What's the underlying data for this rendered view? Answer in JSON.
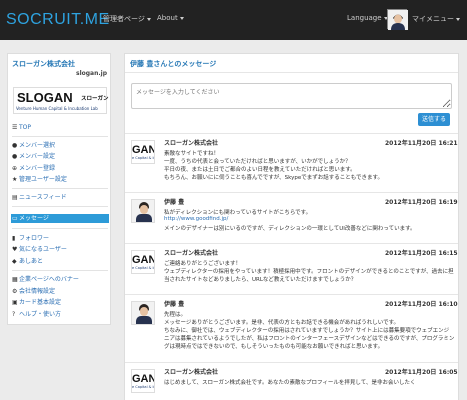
{
  "navbar": {
    "brand": "SOCRUIT.ME",
    "menu_admin": "管理者ページ",
    "menu_about": "About",
    "menu_language": "Language",
    "menu_mymenu": "マイメニュー"
  },
  "sidebar": {
    "company": "スローガン株式会社",
    "url": "slogan.jp",
    "logo": {
      "main": "SLOGAN",
      "jp": "スローガン",
      "sub": "Venture Human Capital & Incubation Lab"
    },
    "items": [
      {
        "label": "TOP",
        "icon": "list-icon"
      },
      {
        "label": "メンバー選択",
        "icon": "user-icon"
      },
      {
        "label": "メンバー設定",
        "icon": "users-icon"
      },
      {
        "label": "メンバー登録",
        "icon": "plus-icon"
      },
      {
        "label": "管理ユーザー設定",
        "icon": "star-icon"
      },
      {
        "label": "ニュースフィード",
        "icon": "newspaper-icon"
      },
      {
        "label": "メッセージ",
        "icon": "inbox-icon"
      },
      {
        "label": "フォロワー",
        "icon": "bookmark-icon"
      },
      {
        "label": "気になるユーザー",
        "icon": "heart-icon"
      },
      {
        "label": "あしあと",
        "icon": "footprint-icon"
      },
      {
        "label": "企業ページへのバナー",
        "icon": "banner-icon"
      },
      {
        "label": "会社情報設定",
        "icon": "gear-icon"
      },
      {
        "label": "カード基本設定",
        "icon": "card-icon"
      },
      {
        "label": "ヘルプ・使い方",
        "icon": "help-icon"
      }
    ]
  },
  "main": {
    "title": "伊藤 豊さんとのメッセージ",
    "compose_placeholder": "メッセージを入力してください",
    "send_label": "送信する",
    "messages": [
      {
        "author": "スローガン株式会社",
        "date": "2012年11月20日 16:21",
        "avatar": "company",
        "lines": [
          "素敵なサイトですね！",
          "一度、うちの代表と会っていただければと思いますが、いかがでしょうか？",
          "平日の夜、または土日でご都合のよい日程を教えていただければと思います。",
          "もちろん、お願いにに伺うことも喜んでですが、Skypeでまずお話することもできます。"
        ]
      },
      {
        "author": "伊藤 豊",
        "date": "2012年11月20日 16:19",
        "avatar": "person",
        "lines": [
          "私がディレクションにも関わっているサイトがこちらです。",
          "http://www.goodfind.jp/",
          "メインのデザイナーは別にいるのですが、ディレクションの一環としてUI改善などに関わっています。"
        ],
        "link_line": 1
      },
      {
        "author": "スローガン株式会社",
        "date": "2012年11月20日 16:15",
        "avatar": "company",
        "lines": [
          "ご連絡ありがとうございます！",
          "ウェブディレクターの採用をやっています！積極採用中です。フロントのデザインができるとのことですが、過去に担",
          "当されたサイトなどありましたら、URLなど教えていただけますでしょうか？"
        ]
      },
      {
        "author": "伊藤 豊",
        "date": "2012年11月20日 16:10",
        "avatar": "person",
        "lines": [
          "先程は。",
          "メッセージありがとうございます。是非、代表の方ともお話できる機会があればうれしいです。",
          "ちなみに、御社では、ウェブディレクターの採用はされていますでしょうか？サイト上には募集要項でウェブエンジ",
          "ニアは募集されているようでしたが、私はフロントのインターフェースデザインなどはできるのですが、プログラミン",
          "グは現時点ではできないので、もしそういったものも可能なお願いできればと思います。"
        ]
      },
      {
        "author": "スローガン株式会社",
        "date": "2012年11月20日 16:05",
        "avatar": "company",
        "lines": [
          "はじめまして、スローガン株式会社です。あなたの素敵なプロフィールを拝見して、是非お会いしたく"
        ]
      }
    ]
  }
}
